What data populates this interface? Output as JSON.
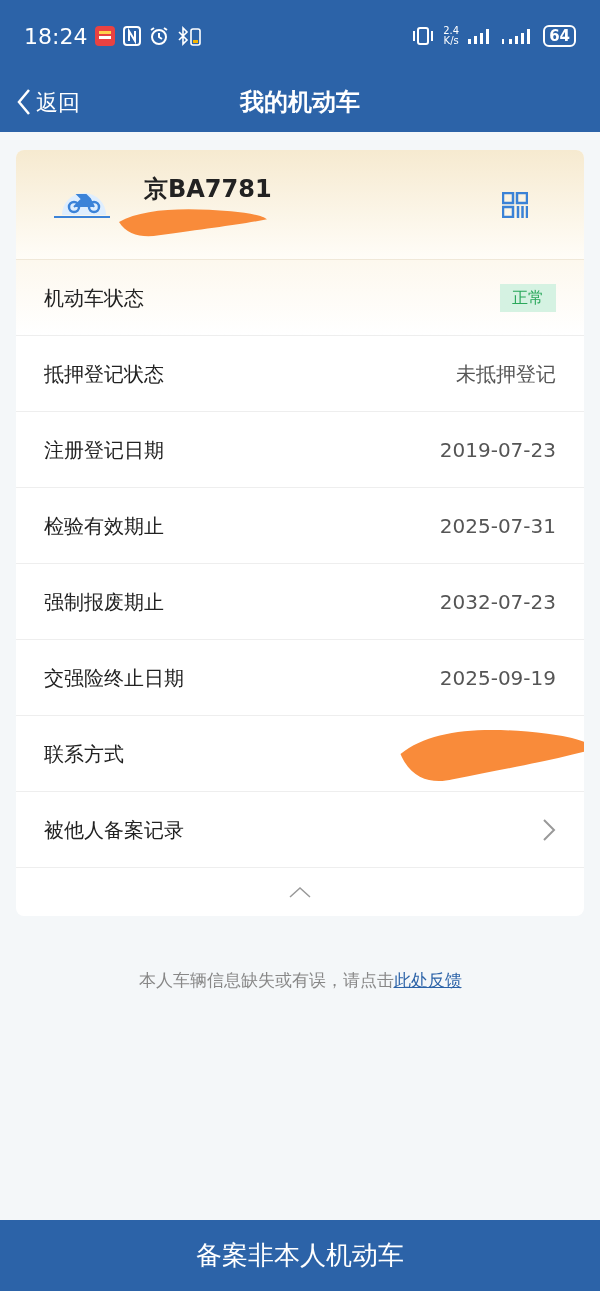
{
  "status_bar": {
    "time": "18:24",
    "net_speed": "2.4",
    "net_unit": "K/s",
    "battery": "64"
  },
  "nav": {
    "back": "返回",
    "title": "我的机动车"
  },
  "vehicle": {
    "plate": "京BA7781"
  },
  "rows": [
    {
      "kind": "badge",
      "label": "机动车状态",
      "value": "正常"
    },
    {
      "kind": "text",
      "label": "抵押登记状态",
      "value": "未抵押登记"
    },
    {
      "kind": "text",
      "label": "注册登记日期",
      "value": "2019-07-23"
    },
    {
      "kind": "text",
      "label": "检验有效期止",
      "value": "2025-07-31"
    },
    {
      "kind": "text",
      "label": "强制报废期止",
      "value": "2032-07-23"
    },
    {
      "kind": "text",
      "label": "交强险终止日期",
      "value": "2025-09-19"
    },
    {
      "kind": "hidden",
      "label": "联系方式"
    },
    {
      "kind": "link",
      "label": "被他人备案记录"
    }
  ],
  "feedback": {
    "text": "本人车辆信息缺失或有误，请点击",
    "link": "此处反馈"
  },
  "bottom_button": "备案非本人机动车"
}
